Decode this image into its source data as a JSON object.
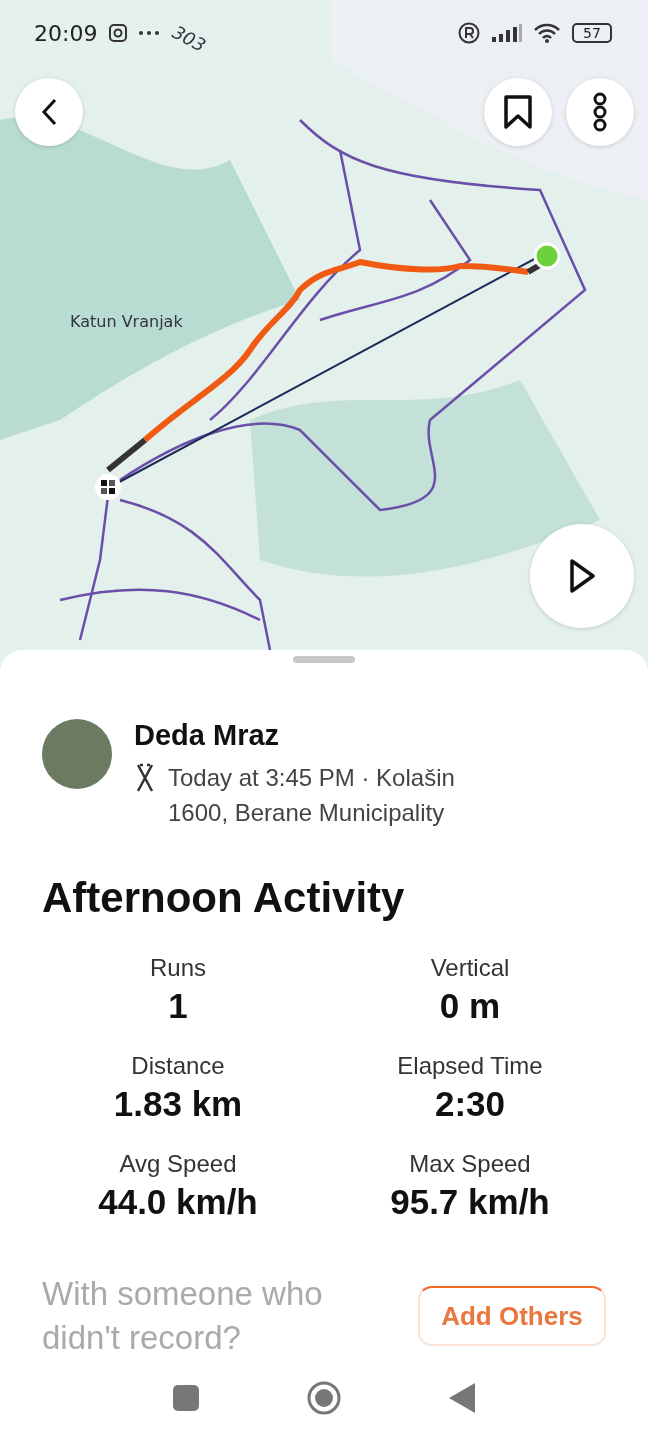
{
  "status_bar": {
    "time": "20:09",
    "battery": "57"
  },
  "map": {
    "labels": [
      {
        "text": "303",
        "kind": "road"
      },
      {
        "text": "Katun Vranjak",
        "kind": "place"
      }
    ]
  },
  "athlete": {
    "name": "Deda Mraz",
    "meta": "Today at 3:45 PM · Kolašin 1600, Berane Municipality"
  },
  "activity": {
    "title": "Afternoon Activity",
    "stats": [
      {
        "label": "Runs",
        "value": "1"
      },
      {
        "label": "Vertical",
        "value": "0 m"
      },
      {
        "label": "Distance",
        "value": "1.83 km"
      },
      {
        "label": "Elapsed Time",
        "value": "2:30"
      },
      {
        "label": "Avg Speed",
        "value": "44.0 km/h"
      },
      {
        "label": "Max Speed",
        "value": "95.7 km/h"
      }
    ]
  },
  "add_others": {
    "prompt": "With someone who didn't record?",
    "button": "Add Others"
  }
}
